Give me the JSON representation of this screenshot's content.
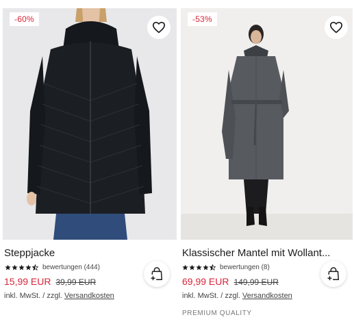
{
  "products": [
    {
      "image_alt": "Steppjacke",
      "discount_badge": "-60%",
      "title": "Steppjacke",
      "rating": 4.5,
      "rating_text": "bewertungen (444)",
      "price_current": "15,99 EUR",
      "price_original": "39,99 EUR",
      "tax_prefix": "inkl. MwSt. / zzgl.",
      "shipping_link": "Versandkosten",
      "favorite_icon": "heart-icon",
      "cart_icon": "add-to-bag-icon"
    },
    {
      "image_alt": "Klassischer Mantel mit Wollanteil",
      "discount_badge": "-53%",
      "title": "Klassischer Mantel mit Wollant...",
      "rating": 4.5,
      "rating_text": "bewertungen (8)",
      "price_current": "69,99 EUR",
      "price_original": "149,99 EUR",
      "tax_prefix": "inkl. MwSt. / zzgl.",
      "shipping_link": "Versandkosten",
      "tag": "PREMIUM QUALITY",
      "favorite_icon": "heart-icon",
      "cart_icon": "add-to-bag-icon"
    }
  ],
  "colors": {
    "sale_red": "#d8243a",
    "star": "#1a1a1a",
    "text": "#1a1a1a"
  }
}
